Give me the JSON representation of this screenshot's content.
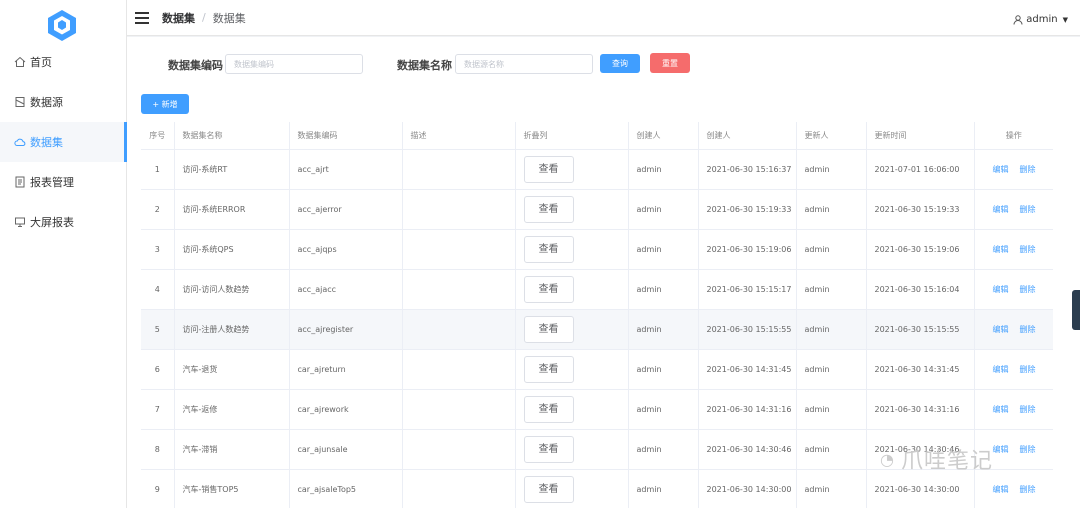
{
  "colors": {
    "primary": "#409eff",
    "danger": "#f56c6c"
  },
  "sidebar": {
    "logo": "logo-icon",
    "items": [
      {
        "label": "首页",
        "icon": "home-icon",
        "active": false
      },
      {
        "label": "数据源",
        "icon": "database-icon",
        "active": false
      },
      {
        "label": "数据集",
        "icon": "cloud-icon",
        "active": true
      },
      {
        "label": "报表管理",
        "icon": "report-icon",
        "active": false
      },
      {
        "label": "大屏报表",
        "icon": "screen-icon",
        "active": false
      }
    ]
  },
  "header": {
    "breadcrumb": [
      "数据集",
      "数据集"
    ],
    "user": "admin"
  },
  "search": {
    "code_label": "数据集编码",
    "code_placeholder": "数据集编码",
    "name_label": "数据集名称",
    "name_placeholder": "数据源名称",
    "query_label": "查询",
    "reset_label": "重置",
    "add_label": "+ 新增"
  },
  "table": {
    "columns": [
      "序号",
      "数据集名称",
      "数据集编码",
      "描述",
      "折叠列",
      "创建人",
      "创建人",
      "更新人",
      "更新时间",
      "操作"
    ],
    "view_label": "查看",
    "edit_label": "编辑",
    "delete_label": "删除",
    "rows": [
      {
        "no": "1",
        "name": "访问-系统RT",
        "code": "acc_ajrt",
        "desc": "",
        "creator": "admin",
        "created": "2021-06-30 15:16:37",
        "updater": "admin",
        "updated": "2021-07-01 16:06:00"
      },
      {
        "no": "2",
        "name": "访问-系统ERROR",
        "code": "acc_ajerror",
        "desc": "",
        "creator": "admin",
        "created": "2021-06-30 15:19:33",
        "updater": "admin",
        "updated": "2021-06-30 15:19:33"
      },
      {
        "no": "3",
        "name": "访问-系统QPS",
        "code": "acc_ajqps",
        "desc": "",
        "creator": "admin",
        "created": "2021-06-30 15:19:06",
        "updater": "admin",
        "updated": "2021-06-30 15:19:06"
      },
      {
        "no": "4",
        "name": "访问-访问人数趋势",
        "code": "acc_ajacc",
        "desc": "",
        "creator": "admin",
        "created": "2021-06-30 15:15:17",
        "updater": "admin",
        "updated": "2021-06-30 15:16:04"
      },
      {
        "no": "5",
        "name": "访问-注册人数趋势",
        "code": "acc_ajregister",
        "desc": "",
        "creator": "admin",
        "created": "2021-06-30 15:15:55",
        "updater": "admin",
        "updated": "2021-06-30 15:15:55"
      },
      {
        "no": "6",
        "name": "汽车-退货",
        "code": "car_ajreturn",
        "desc": "",
        "creator": "admin",
        "created": "2021-06-30 14:31:45",
        "updater": "admin",
        "updated": "2021-06-30 14:31:45"
      },
      {
        "no": "7",
        "name": "汽车-返修",
        "code": "car_ajrework",
        "desc": "",
        "creator": "admin",
        "created": "2021-06-30 14:31:16",
        "updater": "admin",
        "updated": "2021-06-30 14:31:16"
      },
      {
        "no": "8",
        "name": "汽车-滞销",
        "code": "car_ajunsale",
        "desc": "",
        "creator": "admin",
        "created": "2021-06-30 14:30:46",
        "updater": "admin",
        "updated": "2021-06-30 14:30:46"
      },
      {
        "no": "9",
        "name": "汽车-销售TOP5",
        "code": "car_ajsaleTop5",
        "desc": "",
        "creator": "admin",
        "created": "2021-06-30 14:30:00",
        "updater": "admin",
        "updated": "2021-06-30 14:30:00"
      }
    ]
  },
  "watermark": {
    "text": "爪哇笔记",
    "icon": "wechat-icon"
  }
}
